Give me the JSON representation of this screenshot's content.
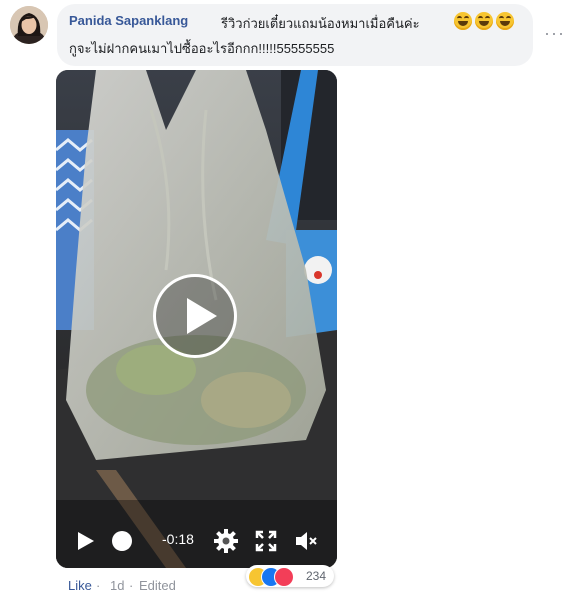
{
  "comment": {
    "author": "Panida Sapanklang",
    "text_line1": "รีวิวก่วยเตี๋ยวแถมน้องหมาเมื่อคืนค่ะ",
    "text_line2": "กูจะไม่ฝากคนเมาไปซื้ออะไรอีกกก!!!!!55555555",
    "emojis": [
      "laughing-tears-emoji",
      "laughing-tears-emoji",
      "laughing-tears-emoji"
    ],
    "more_options_icon": "ellipsis-icon"
  },
  "video": {
    "time_remaining": "-0:18",
    "icons": [
      "play-icon",
      "scrubber-handle",
      "settings-gear-icon",
      "fullscreen-icon",
      "mute-icon"
    ]
  },
  "footer": {
    "like_label": "Like",
    "separator": "·",
    "timestamp": "1d",
    "edited_label": "Edited"
  },
  "reactions": {
    "count": "234",
    "types": [
      "haha",
      "like",
      "love"
    ]
  },
  "colors": {
    "link_blue": "#385898",
    "bubble_bg": "#f2f3f5",
    "meta_gray": "#90949c"
  }
}
